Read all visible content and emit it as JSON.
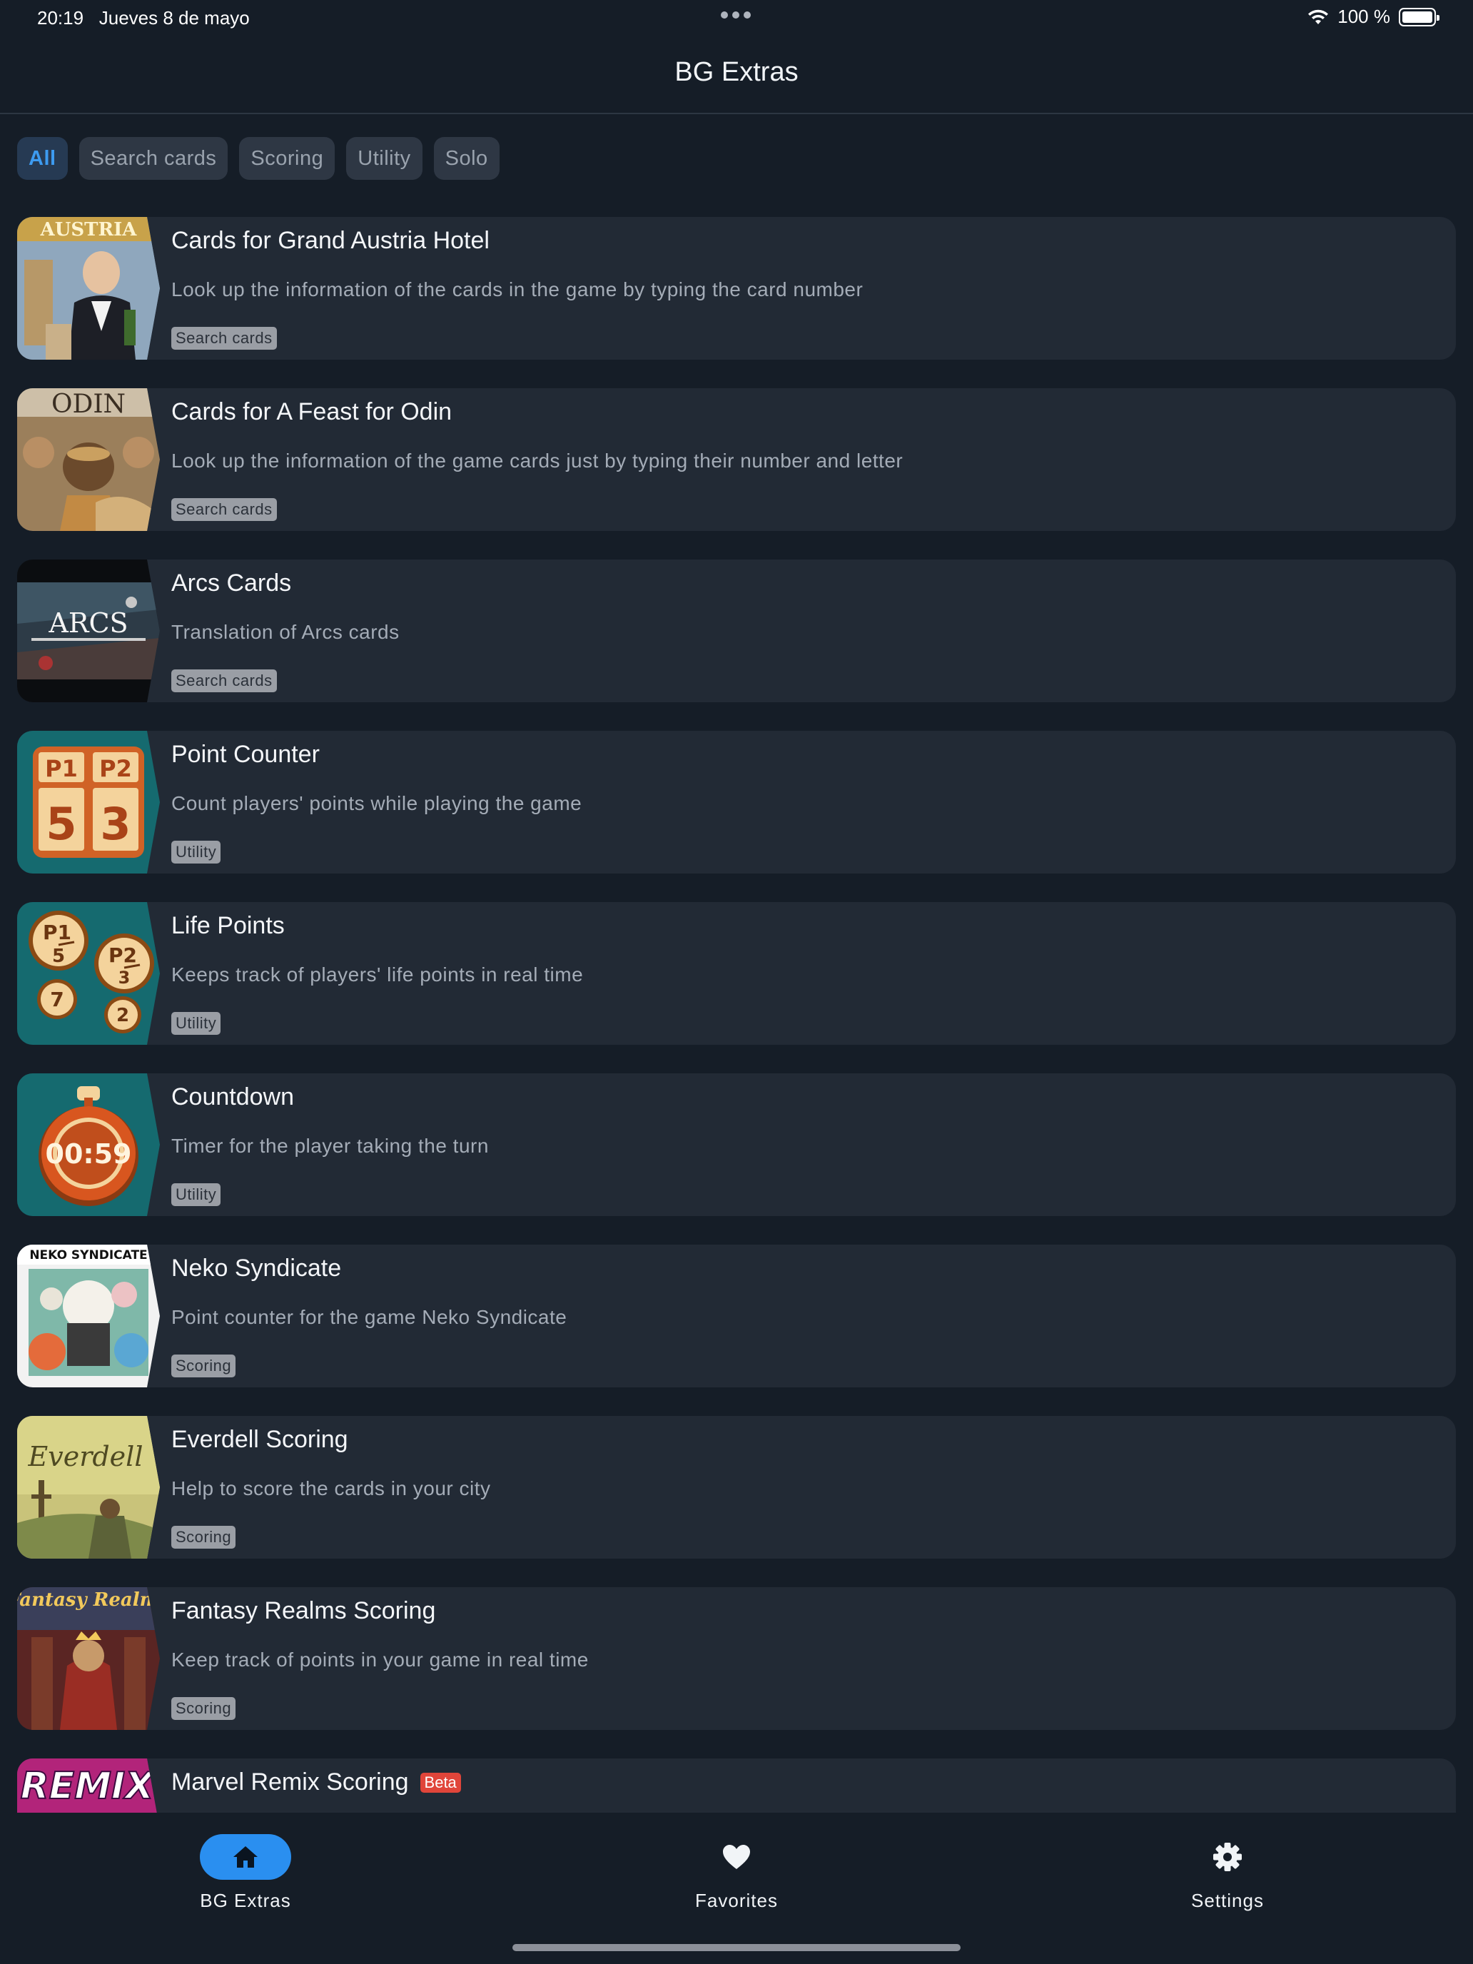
{
  "status_bar": {
    "time": "20:19",
    "date": "Jueves 8 de mayo",
    "battery": "100 %"
  },
  "header": {
    "title": "BG Extras"
  },
  "filters": [
    {
      "label": "All",
      "active": true
    },
    {
      "label": "Search cards",
      "active": false
    },
    {
      "label": "Scoring",
      "active": false
    },
    {
      "label": "Utility",
      "active": false
    },
    {
      "label": "Solo",
      "active": false
    }
  ],
  "items": [
    {
      "title": "Cards for Grand Austria Hotel",
      "description": "Look up the information of the cards in the game by typing the card number",
      "tag": "Search cards",
      "thumb_text": "AUSTRIA"
    },
    {
      "title": "Cards for A Feast for Odin",
      "description": "Look up the information of the game cards just by typing their number and letter",
      "tag": "Search cards",
      "thumb_text": "ODIN"
    },
    {
      "title": "Arcs Cards",
      "description": "Translation of Arcs cards",
      "tag": "Search cards",
      "thumb_text": "ARCS"
    },
    {
      "title": "Point Counter",
      "description": "Count players' points while playing the game",
      "tag": "Utility",
      "thumb_text": ""
    },
    {
      "title": "Life Points",
      "description": "Keeps track of players' life points in real time",
      "tag": "Utility",
      "thumb_text": ""
    },
    {
      "title": "Countdown",
      "description": "Timer for the player taking the turn",
      "tag": "Utility",
      "thumb_text": "00:59"
    },
    {
      "title": "Neko Syndicate",
      "description": "Point counter for the game Neko Syndicate",
      "tag": "Scoring",
      "thumb_text": "NEKO SYNDICATE"
    },
    {
      "title": "Everdell Scoring",
      "description": "Help to score the cards in your city",
      "tag": "Scoring",
      "thumb_text": "Everdell"
    },
    {
      "title": "Fantasy Realms Scoring",
      "description": "Keep track of points in your game in real time",
      "tag": "Scoring",
      "thumb_text": "Fantasy Realms"
    },
    {
      "title": "Marvel Remix Scoring",
      "description": "",
      "tag": "",
      "badge": "Beta",
      "thumb_text": "REMIX"
    }
  ],
  "point_counter_thumb": {
    "labels": [
      "P1",
      "P2"
    ],
    "values": [
      "5",
      "3"
    ]
  },
  "life_points_thumb": {
    "labels": [
      "P1",
      "P2"
    ],
    "values": [
      "5",
      "3",
      "7",
      "2"
    ]
  },
  "nav": [
    {
      "label": "BG Extras",
      "icon": "home-icon",
      "active": true
    },
    {
      "label": "Favorites",
      "icon": "heart-icon",
      "active": false
    },
    {
      "label": "Settings",
      "icon": "gear-icon",
      "active": false
    }
  ],
  "colors": {
    "background": "#151d27",
    "card": "#222a35",
    "accent": "#2a8ff0",
    "teal": "#156a6f",
    "beta": "#e0453a"
  }
}
